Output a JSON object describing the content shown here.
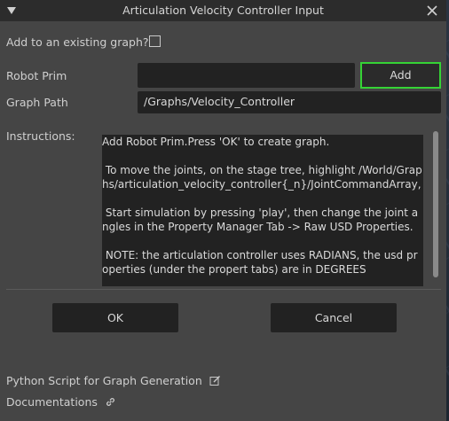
{
  "window": {
    "title": "Articulation Velocity Controller Input"
  },
  "form": {
    "add_existing_label": "Add to an existing graph?",
    "add_existing_checked": false,
    "robot_prim_label": "Robot Prim",
    "robot_prim_value": "",
    "add_button_label": "Add",
    "graph_path_label": "Graph Path",
    "graph_path_value": "/Graphs/Velocity_Controller",
    "instructions_label": "Instructions:",
    "instructions_text": "Add Robot Prim.Press 'OK' to create graph.\n\n To move the joints, on the stage tree, highlight /World/Graphs/articulation_velocity_controller{_n}/JointCommandArray,\n\n Start simulation by pressing 'play', then change the joint angles in the Property Manager Tab -> Raw USD Properties.\n\n NOTE: the articulation controller uses RADIANS, the usd properties (under the propert tabs) are in DEGREES"
  },
  "buttons": {
    "ok_label": "OK",
    "cancel_label": "Cancel"
  },
  "footer": {
    "python_script_label": "Python Script for Graph Generation",
    "documentations_label": "Documentations"
  },
  "icons": {
    "collapse": "triangle-down-icon",
    "close": "close-icon",
    "edit": "edit-icon",
    "link": "link-icon"
  },
  "colors": {
    "highlight": "#35d335",
    "window_bg": "#454545",
    "field_bg": "#222222"
  }
}
